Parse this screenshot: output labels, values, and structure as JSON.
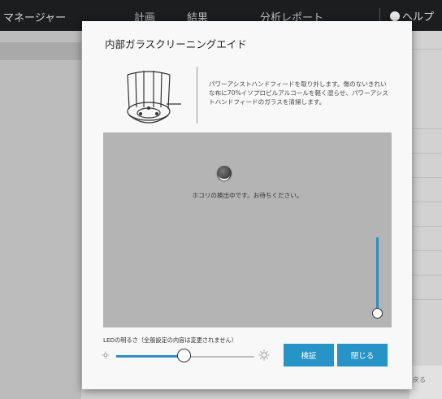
{
  "app": {
    "title": "マネージャー",
    "nav": [
      "計画",
      "結果",
      "分析レポート"
    ],
    "help_label": "ヘルプ",
    "footer_label": "戻る"
  },
  "dialog": {
    "title": "内部ガラスクリーニングエイド",
    "instructions": "パワーアシストハンドフィードを取り外します。傷のないきれいな布に70%イソプロピルアルコールを軽く湿らせ、パワーアシストハンドフィードのガラスを清掃します。",
    "status": "ホコリの検出中です。お待ちください。",
    "led_label": "LEDの明るさ（全般設定の内容は変更されません）",
    "led_level": 0.48,
    "focus_level": 0.0,
    "buttons": {
      "verify": "検証",
      "close": "閉じる"
    }
  },
  "colors": {
    "accent": "#2794c8",
    "topbar": "#1b1d1f",
    "camera_bg": "#b4b4b4"
  },
  "icons": [
    "power-assist-hand-feed-icon",
    "brightness-low-icon",
    "brightness-high-icon",
    "help-icon",
    "loading-spinner-icon"
  ]
}
